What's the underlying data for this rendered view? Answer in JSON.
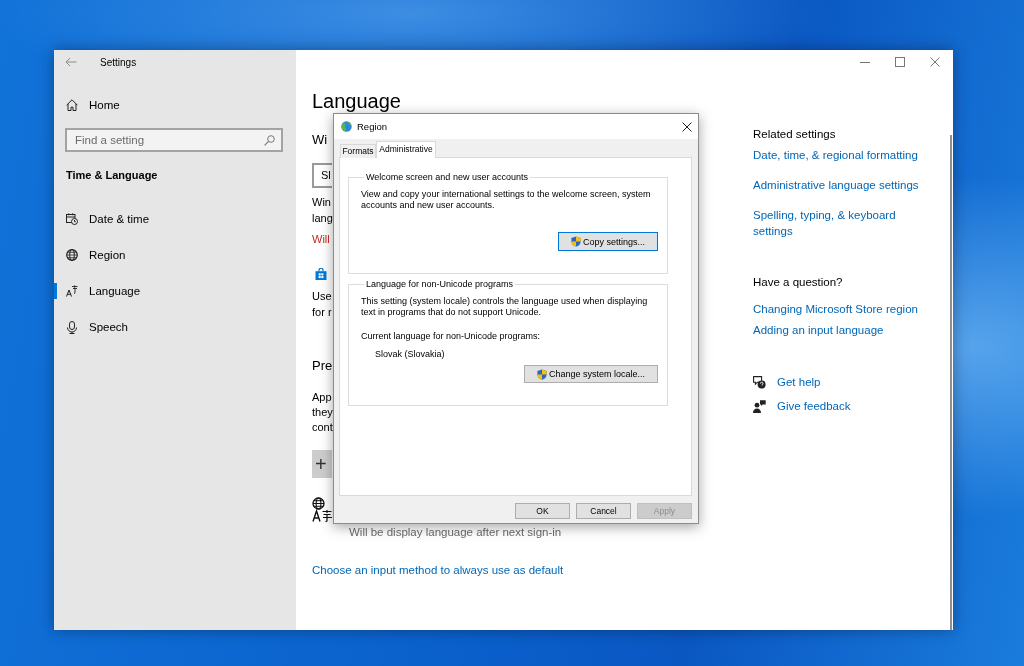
{
  "window": {
    "title": "Settings"
  },
  "sidebar": {
    "home": "Home",
    "search": {
      "placeholder": "Find a setting"
    },
    "section": "Time & Language",
    "items": [
      {
        "label": "Date & time",
        "selected": false
      },
      {
        "label": "Region",
        "selected": false
      },
      {
        "label": "Language",
        "selected": true
      },
      {
        "label": "Speech",
        "selected": false
      }
    ]
  },
  "main": {
    "title": "Language",
    "display_language": {
      "heading": "Wi",
      "dropdown": {
        "value": "Sl"
      },
      "description": [
        "Win",
        "lang"
      ],
      "warning": "Will"
    },
    "store_note": [
      "Use",
      "for r"
    ],
    "preferred_languages": {
      "heading": "Pre",
      "description": [
        "App",
        "they",
        "cont"
      ],
      "add_button": "+",
      "status": "Will be display language after next sign-in"
    },
    "input_method_link": "Choose an input method to always use as default"
  },
  "related_settings": {
    "heading": "Related settings",
    "links": [
      "Date, time, & regional formatting",
      "Administrative language settings",
      "Spelling, typing, & keyboard settings"
    ]
  },
  "question": {
    "heading": "Have a question?",
    "links": [
      "Changing Microsoft Store region",
      "Adding an input language"
    ]
  },
  "help_links": [
    "Get help",
    "Give feedback"
  ],
  "dialog": {
    "title": "Region",
    "tabs": [
      {
        "label": "Formats",
        "selected": false
      },
      {
        "label": "Administrative",
        "selected": true
      }
    ],
    "groups": [
      {
        "title": "Welcome screen and new user accounts",
        "text": "View and copy your international settings to the welcome screen, system accounts and new user accounts.",
        "button": {
          "label": "Copy settings...",
          "focused": true
        }
      },
      {
        "title": "Language for non-Unicode programs",
        "text": "This setting (system locale) controls the language used when displaying text in programs that do not support Unicode.",
        "current_label": "Current language for non-Unicode programs:",
        "current_value": "Slovak (Slovakia)",
        "button": {
          "label": "Change system locale...",
          "focused": false
        }
      }
    ],
    "buttons": [
      {
        "label": "OK",
        "disabled": false
      },
      {
        "label": "Cancel",
        "disabled": false
      },
      {
        "label": "Apply",
        "disabled": true
      }
    ]
  }
}
